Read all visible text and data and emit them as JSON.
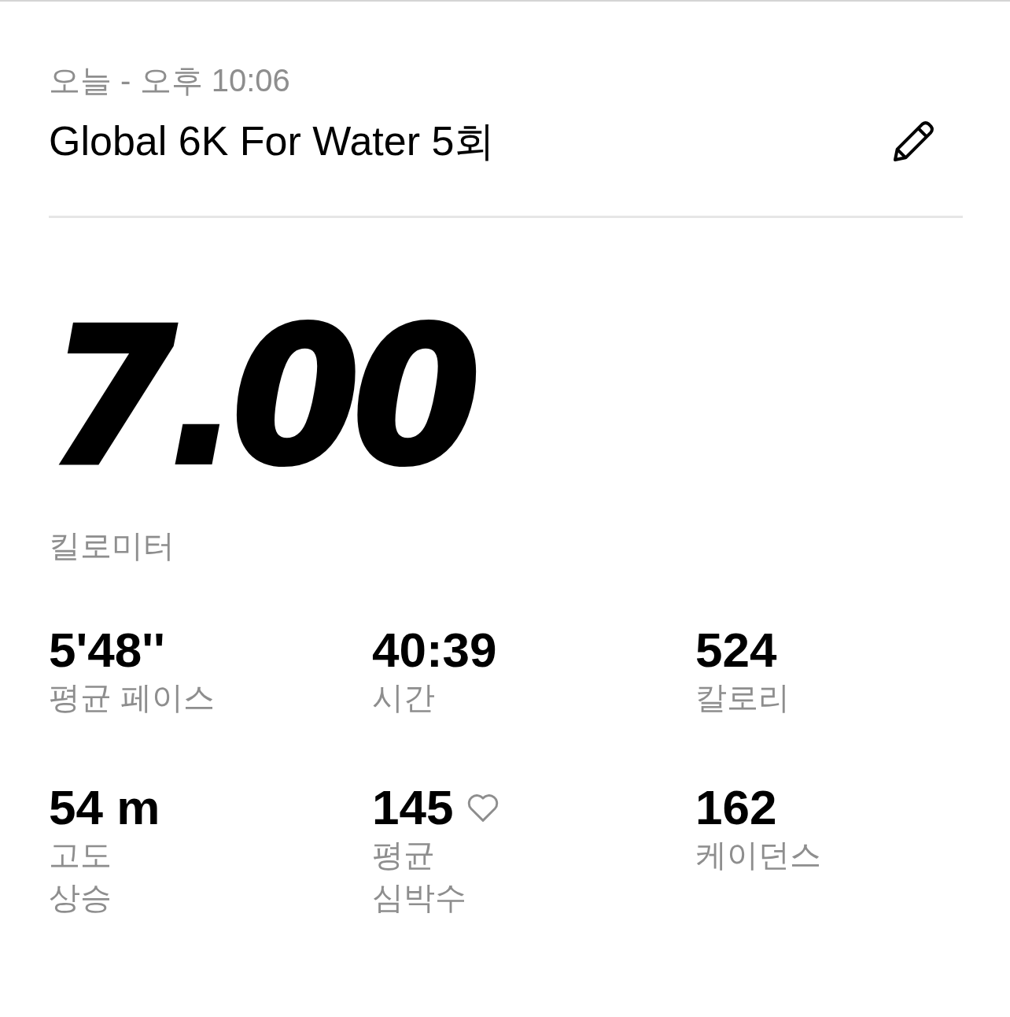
{
  "header": {
    "date": "오늘 - 오후 10:06",
    "title": "Global 6K For Water 5회"
  },
  "distance": {
    "value": "7.00",
    "unit": "킬로미터"
  },
  "stats": [
    {
      "kind": "plain",
      "value": "5'48''",
      "label_lines": [
        "평균 페이스"
      ]
    },
    {
      "kind": "plain",
      "value": "40:39",
      "label_lines": [
        "시간"
      ]
    },
    {
      "kind": "plain",
      "value": "524",
      "label_lines": [
        "칼로리"
      ]
    },
    {
      "kind": "plain",
      "value": "54 m",
      "label_lines": [
        "고도",
        "상승"
      ]
    },
    {
      "kind": "heart_rate",
      "value": "145",
      "label_lines": [
        "평균",
        "심박수"
      ]
    },
    {
      "kind": "plain",
      "value": "162",
      "label_lines": [
        "케이던스"
      ]
    }
  ]
}
